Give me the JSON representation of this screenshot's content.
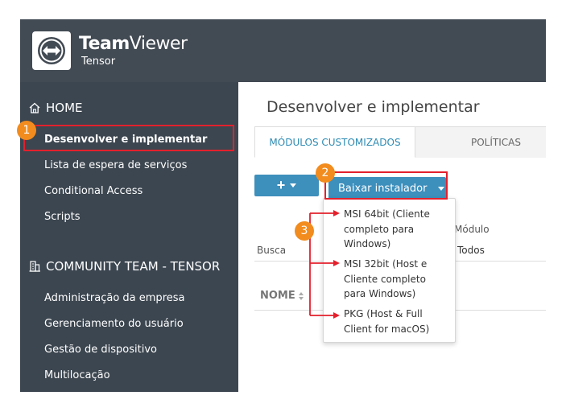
{
  "header": {
    "brand_bold": "Team",
    "brand_regular": "Viewer",
    "brand_sub": "Tensor"
  },
  "sidebar": {
    "home_label": "HOME",
    "items_top": [
      {
        "label": "Desenvolver e implementar",
        "active": true
      },
      {
        "label": "Lista de espera de serviços"
      },
      {
        "label": "Conditional Access"
      },
      {
        "label": "Scripts"
      }
    ],
    "community_label": "COMMUNITY TEAM - TENSOR",
    "items_bottom": [
      {
        "label": "Administração da empresa"
      },
      {
        "label": "Gerenciamento do usuário"
      },
      {
        "label": "Gestão de dispositivo"
      },
      {
        "label": "Multilocação"
      }
    ]
  },
  "main": {
    "title": "Desenvolver e implementar",
    "tabs": [
      {
        "label": "MÓDULOS CUSTOMIZADOS",
        "active": true
      },
      {
        "label": "POLÍTICAS",
        "active": false
      }
    ],
    "add_button_label": "+",
    "download_button_label": "Baixar instalador",
    "search_label": "Busca",
    "module_label": "Módulo",
    "module_value": "Todos",
    "column_name": "NOME"
  },
  "download_menu": {
    "items": [
      {
        "label": "MSI 64bit (Cliente completo para Windows)"
      },
      {
        "label": "MSI 32bit (Host e Cliente completo para Windows)"
      },
      {
        "label": "PKG (Host & Full Client for macOS)"
      }
    ]
  },
  "annotations": {
    "step1": "1",
    "step2": "2",
    "step3": "3"
  },
  "colors": {
    "header_bg": "#424a53",
    "sidebar_bg": "#3c4650",
    "accent_blue": "#3d8fbc",
    "tab_active_text": "#2d8ab3",
    "highlight_red": "#e3202c",
    "badge_orange": "#f28c1e"
  }
}
